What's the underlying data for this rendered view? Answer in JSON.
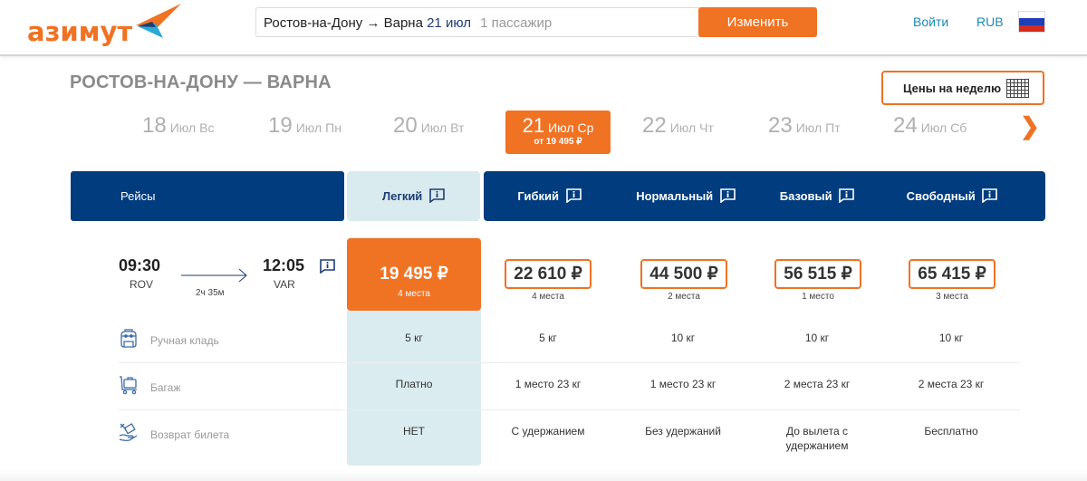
{
  "header": {
    "logo_text": "азимут",
    "search": {
      "route": "Ростов-на-Дону → Варна",
      "date": "21 июл",
      "passengers": "1 пассажир"
    },
    "change_button": "Изменить",
    "login_link": "Войти",
    "currency": "RUB",
    "language_flag": "russia-flag-icon",
    "colors": {
      "brand_orange": "#f07223",
      "brand_blue": "#003c7e",
      "link": "#1a8ab5"
    }
  },
  "route_title": "РОСТОВ-НА-ДОНУ — ВАРНА",
  "week_prices_button": "Цены на неделю",
  "dates": [
    {
      "day": "18",
      "month": "Июл",
      "weekday": "Вс",
      "active": false
    },
    {
      "day": "19",
      "month": "Июл",
      "weekday": "Пн",
      "active": false
    },
    {
      "day": "20",
      "month": "Июл",
      "weekday": "Вт",
      "active": false
    },
    {
      "day": "21",
      "month": "Июл",
      "weekday": "Ср",
      "active": true,
      "price": "от 19 495 ₽"
    },
    {
      "day": "22",
      "month": "Июл",
      "weekday": "Чт",
      "active": false
    },
    {
      "day": "23",
      "month": "Июл",
      "weekday": "Пт",
      "active": false
    },
    {
      "day": "24",
      "month": "Июл",
      "weekday": "Сб",
      "active": false
    }
  ],
  "next_arrow": "❯",
  "table": {
    "flights_header": "Рейсы",
    "fares": [
      {
        "name": "Легкий",
        "price": "19 495 ₽",
        "seats": "4 места",
        "selected": true
      },
      {
        "name": "Гибкий",
        "price": "22 610 ₽",
        "seats": "4 места",
        "selected": false
      },
      {
        "name": "Нормальный",
        "price": "44 500 ₽",
        "seats": "2 места",
        "selected": false
      },
      {
        "name": "Базовый",
        "price": "56 515 ₽",
        "seats": "1 место",
        "selected": false
      },
      {
        "name": "Свободный",
        "price": "65 415 ₽",
        "seats": "3 места",
        "selected": false
      }
    ],
    "flight": {
      "departure_time": "09:30",
      "departure_airport": "ROV",
      "arrival_time": "12:05",
      "arrival_airport": "VAR",
      "duration": "2ч 35м"
    },
    "features": [
      {
        "icon": "backpack-icon",
        "label": "Ручная кладь",
        "values": [
          "5 кг",
          "5 кг",
          "10 кг",
          "10 кг",
          "10 кг"
        ]
      },
      {
        "icon": "luggage-cart-icon",
        "label": "Багаж",
        "values": [
          "Платно",
          "1 место 23 кг",
          "1 место 23 кг",
          "2 места 23 кг",
          "2 места 23 кг"
        ]
      },
      {
        "icon": "ticket-refund-icon",
        "label": "Возврат билета",
        "values": [
          "НЕТ",
          "С удержанием",
          "Без удержаний",
          "До вылета с удержанием",
          "Бесплатно"
        ]
      }
    ]
  }
}
